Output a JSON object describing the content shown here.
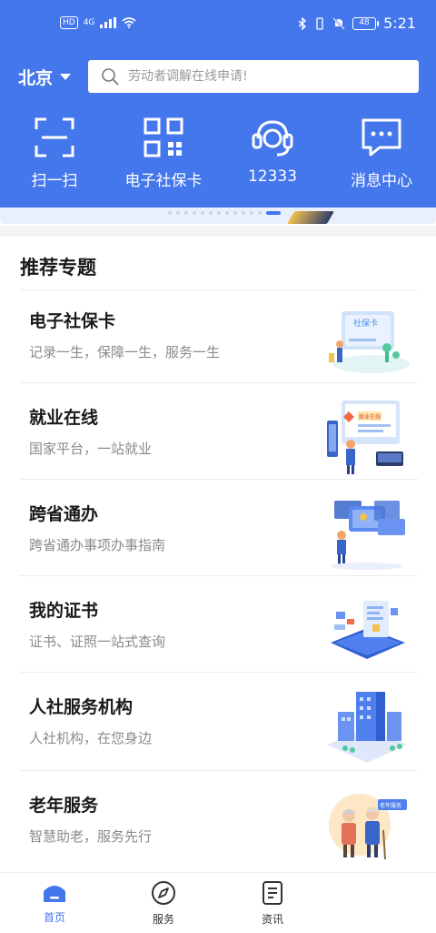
{
  "status_bar": {
    "hd": "HD",
    "network": "4G",
    "battery": "48",
    "time": "5:21"
  },
  "header": {
    "city": "北京",
    "search_placeholder": "劳动者调解在线申请!",
    "accent_color": "#4476EC"
  },
  "quick_actions": [
    {
      "label": "扫一扫",
      "icon": "scan-icon"
    },
    {
      "label": "电子社保卡",
      "icon": "qr-code-icon"
    },
    {
      "label": "12333",
      "icon": "headset-icon"
    },
    {
      "label": "消息中心",
      "icon": "message-icon"
    }
  ],
  "recommend": {
    "title": "推荐专题",
    "items": [
      {
        "title": "电子社保卡",
        "subtitle": "记录一生，保障一生，服务一生",
        "art_text": "社保卡"
      },
      {
        "title": "就业在线",
        "subtitle": "国家平台，一站就业",
        "art_text": "就业在线"
      },
      {
        "title": "跨省通办",
        "subtitle": "跨省通办事项办事指南"
      },
      {
        "title": "我的证书",
        "subtitle": "证书、证照一站式查询"
      },
      {
        "title": "人社服务机构",
        "subtitle": "人社机构，在您身边"
      },
      {
        "title": "老年服务",
        "subtitle": "智慧助老，服务先行",
        "art_text": "老年服务"
      }
    ]
  },
  "tabbar": {
    "tabs": [
      {
        "label": "首页",
        "icon": "home-icon",
        "active": true
      },
      {
        "label": "服务",
        "icon": "compass-icon",
        "active": false
      },
      {
        "label": "资讯",
        "icon": "news-icon",
        "active": false
      }
    ]
  }
}
